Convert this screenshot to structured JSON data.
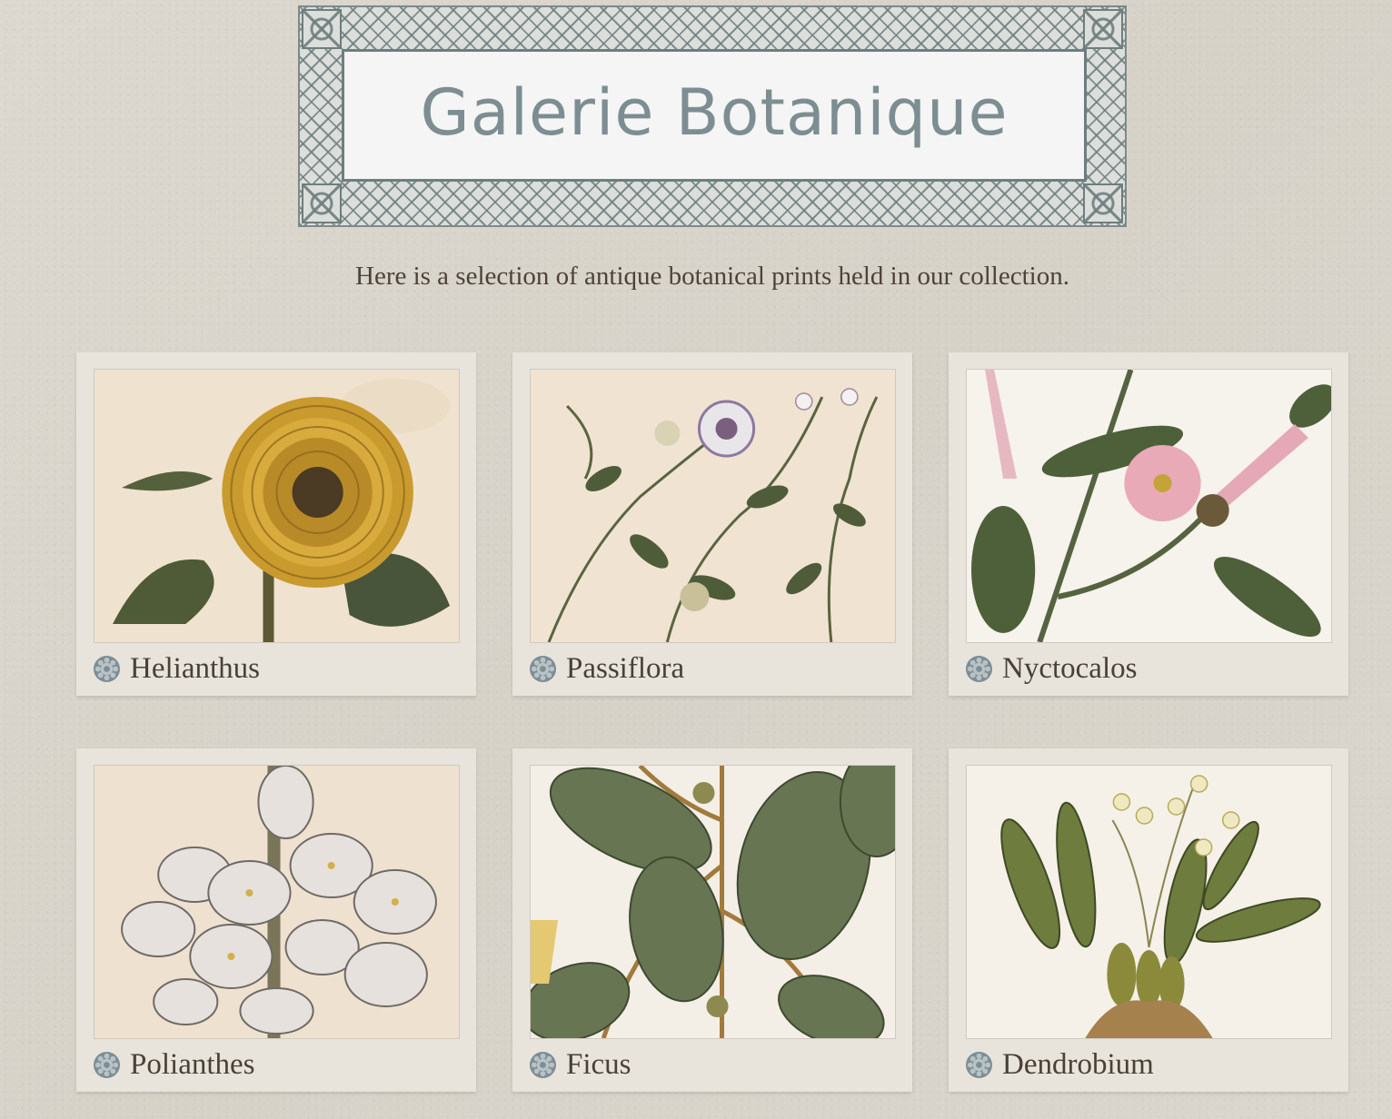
{
  "header": {
    "title": "Galerie Botanique"
  },
  "intro": {
    "text": "Here is a selection of antique botanical prints held in our collection."
  },
  "gallery": {
    "items": [
      {
        "label": "Helianthus",
        "icon": "gear-icon"
      },
      {
        "label": "Passiflora",
        "icon": "gear-icon"
      },
      {
        "label": "Nyctocalos",
        "icon": "gear-icon"
      },
      {
        "label": "Polianthes",
        "icon": "gear-icon"
      },
      {
        "label": "Ficus",
        "icon": "gear-icon"
      },
      {
        "label": "Dendrobium",
        "icon": "gear-icon"
      }
    ]
  },
  "colors": {
    "background": "#d9d5cc",
    "card": "#e8e4dc",
    "title": "#7d8e92",
    "text": "#4a4036",
    "icon": "#7d8e96"
  }
}
